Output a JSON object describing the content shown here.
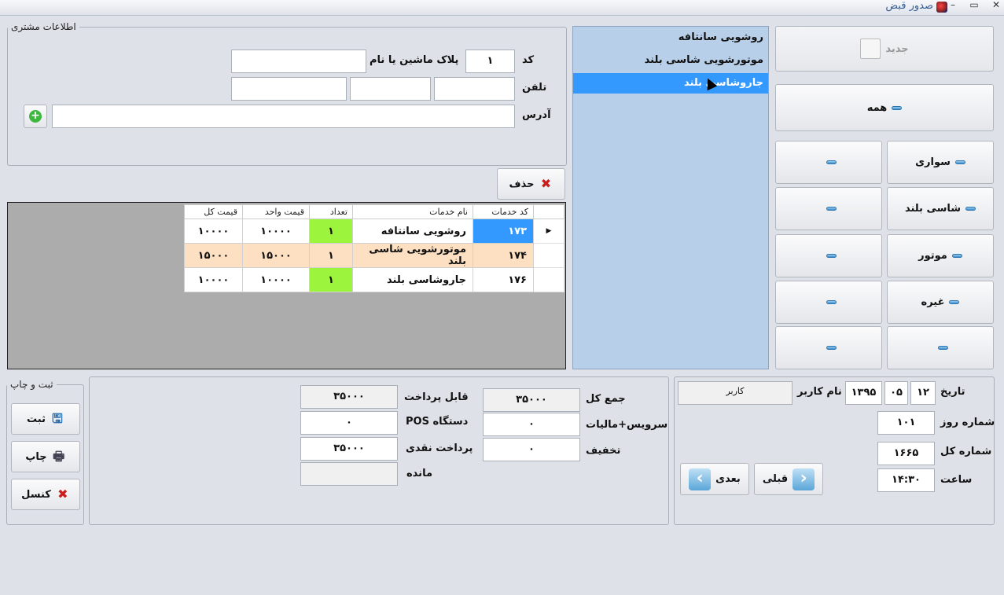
{
  "window": {
    "title": "صدور قبض",
    "minimize": "–",
    "maximize": "▭",
    "close": "✕"
  },
  "customer": {
    "legend": "اطلاعات مشتری",
    "code_label": "کد",
    "code_value": "۱",
    "plate_label": "پلاک ماشین یا نام",
    "plate_value": "",
    "phone_label": "تلفن",
    "address_label": "آدرس",
    "add_icon": "plus-circle-icon"
  },
  "delete_button": "حذف",
  "grid": {
    "headers": [
      "کد خدمات",
      "نام خدمات",
      "تعداد",
      "قیمت واحد",
      "قیمت کل"
    ],
    "rows": [
      {
        "code": "۱۷۳",
        "name": "روشویی سانتافه",
        "qty": "۱",
        "unit": "۱۰۰۰۰",
        "total": "۱۰۰۰۰"
      },
      {
        "code": "۱۷۴",
        "name": "موتورشویی شاسی بلند",
        "qty": "۱",
        "unit": "۱۵۰۰۰",
        "total": "۱۵۰۰۰"
      },
      {
        "code": "۱۷۶",
        "name": "جاروشاسی بلند",
        "qty": "۱",
        "unit": "۱۰۰۰۰",
        "total": "۱۰۰۰۰"
      }
    ]
  },
  "service_list": [
    "روشویی سانتافه",
    "موتورشویی شاسی بلند",
    "جاروشاسی بلند"
  ],
  "categories": {
    "new_button": "جدید",
    "all_button": "همه",
    "right_column": [
      "سواری",
      "شاسی بلند",
      "موتور",
      "غیره",
      ""
    ],
    "left_column": [
      "",
      "",
      "",
      "",
      ""
    ]
  },
  "save_print": {
    "legend": "ثبت و چاپ",
    "save": "ثبت",
    "print": "چاپ",
    "cancel": "کنسل"
  },
  "payment": {
    "total_label": "جمع کل",
    "total_value": "۳۵۰۰۰",
    "tax_label": "سرویس+مالیات",
    "tax_value": "۰",
    "discount_label": "تخفیف",
    "discount_value": "۰",
    "payable_label": "قابل پرداخت",
    "payable_value": "۳۵۰۰۰",
    "pos_label": "دستگاه POS",
    "pos_value": "۰",
    "cash_label": "پرداخت نقدی",
    "cash_value": "۳۵۰۰۰",
    "remain_label": "مانده",
    "remain_value": ""
  },
  "receipt": {
    "date_label": "تاریخ",
    "day": "۱۲",
    "month": "۰۵",
    "year": "۱۳۹۵",
    "user_label": "نام کاربر",
    "user_value": "کاربر",
    "day_number_label": "شماره روز",
    "day_number": "۱۰۱",
    "total_number_label": "شماره کل",
    "total_number": "۱۶۶۵",
    "time_label": "ساعت",
    "time": "۱۴:۳۰",
    "prev_button": "قبلی",
    "next_button": "بعدی"
  }
}
